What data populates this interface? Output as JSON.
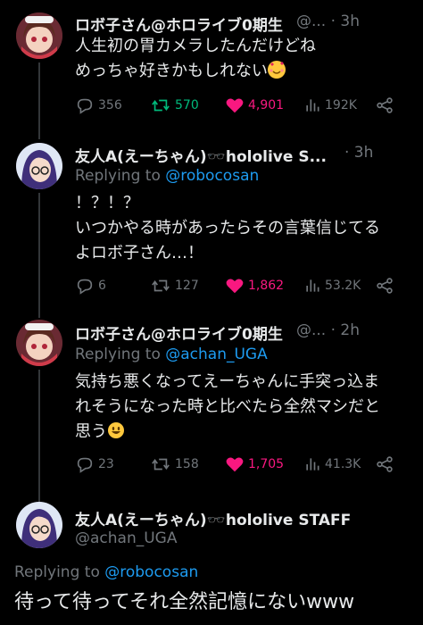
{
  "posts": [
    {
      "name": "ロボ子さん@ホロライブ0期生",
      "meta": "@... · 3h",
      "lines": [
        "人生初の胃カメラしたんだけどね",
        "めっちゃ好きかもしれない"
      ],
      "emoji": "smiling-face-with-hearts",
      "replies": "356",
      "reposts": "570",
      "likes": "4,901",
      "views": "192K"
    },
    {
      "name": "友人A(えーちゃん)🕶️hololive S...",
      "meta": "· 3h",
      "replying_label": "Replying to",
      "replying_to": "@robocosan",
      "lines": [
        "！？！？",
        "いつかやる時があったらその言葉信じてる",
        "よロボ子さん…！"
      ],
      "replies": "6",
      "reposts": "127",
      "likes": "1,862",
      "views": "53.2K"
    },
    {
      "name": "ロボ子さん@ホロライブ0期生",
      "meta": "@... · 2h",
      "replying_label": "Replying to",
      "replying_to": "@achan_UGA",
      "lines": [
        "気持ち悪くなってえーちゃんに手突っ込ま",
        "れそうになった時と比べたら全然マシだと",
        "思う"
      ],
      "emoji": "grinning-face",
      "replies": "23",
      "reposts": "158",
      "likes": "1,705",
      "views": "41.3K"
    }
  ],
  "main_post": {
    "name": "友人A(えーちゃん)🕶️hololive STAFF",
    "handle": "@achan_UGA",
    "replying_label": "Replying to",
    "replying_to": "@robocosan",
    "text": "待って待ってそれ全然記憶にないwww"
  },
  "colors": {
    "background": "#000000",
    "text": "#e7e9ea",
    "muted": "#71767b",
    "link": "#1d9bf0",
    "repost": "#00ba7c",
    "like": "#f91880"
  }
}
